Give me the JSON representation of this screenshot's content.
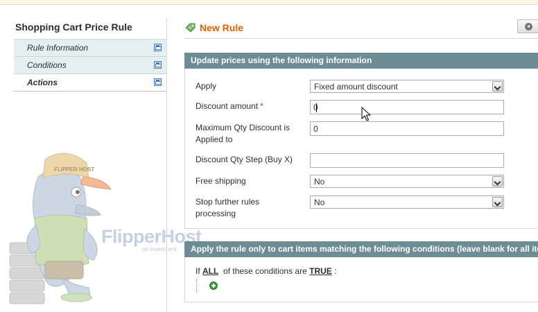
{
  "sidebar": {
    "title": "Shopping Cart Price Rule",
    "items": [
      {
        "label": "Rule Information"
      },
      {
        "label": "Conditions"
      },
      {
        "label": "Actions"
      }
    ]
  },
  "header": {
    "title": "New Rule"
  },
  "actions_section": {
    "legend": "Update prices using the following information",
    "apply": {
      "label": "Apply",
      "value": "Fixed amount discount"
    },
    "discount_amount": {
      "label": "Discount amount",
      "required_mark": "*",
      "value": "0"
    },
    "max_qty": {
      "label_line1": "Maximum Qty Discount is",
      "label_line2": "Applied to",
      "value": "0"
    },
    "qty_step": {
      "label": "Discount Qty Step (Buy X)",
      "value": ""
    },
    "free_shipping": {
      "label": "Free shipping",
      "value": "No"
    },
    "stop_rules": {
      "label_line1": "Stop further rules",
      "label_line2": "processing",
      "value": "No"
    }
  },
  "conditions_section": {
    "legend": "Apply the rule only to cart items matching the following conditions (leave blank for all items)",
    "prefix": "If",
    "aggregator": "ALL",
    "middle": "of these conditions are",
    "value": "TRUE",
    "suffix": ":"
  },
  "watermark": {
    "brand_flipper": "Flipper",
    "brand_host": "Host",
    "tagline": "an investment",
    "cap_text": "FLIPPER HOST"
  },
  "colors": {
    "title_orange": "#eb5e00",
    "legend_bg": "#6e8c94",
    "sidebar_tab_bg": "#e6efef"
  }
}
